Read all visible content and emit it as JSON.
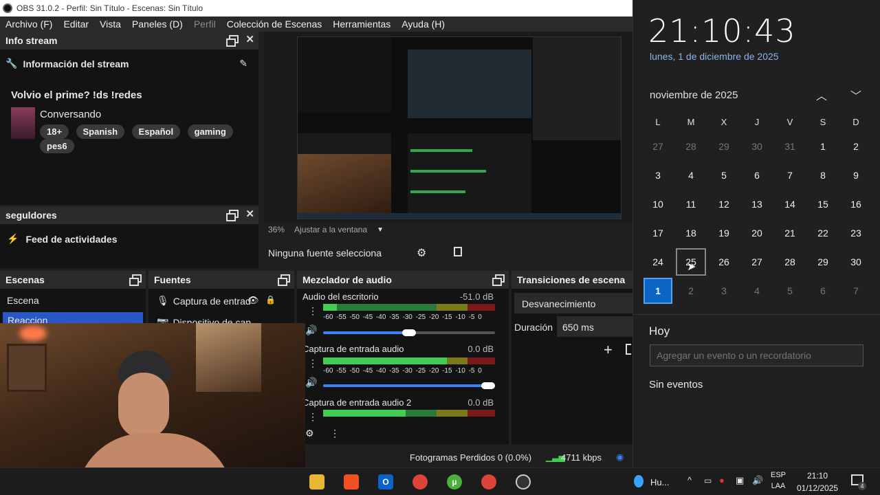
{
  "obs": {
    "title": "OBS 31.0.2 - Perfil: Sin Título - Escenas: Sin Título",
    "menu": [
      "Archivo (F)",
      "Editar",
      "Vista",
      "Paneles (D)",
      "Perfil",
      "Colección de Escenas",
      "Herramientas",
      "Ayuda (H)"
    ],
    "info_dock_title": "Info stream",
    "info_header": "Información del stream",
    "stream_title": "Volvio el prime? !ds !redes",
    "category": "Conversando",
    "tags": [
      "18+",
      "Spanish",
      "Español",
      "gaming",
      "pes6"
    ],
    "followers_dock_title": "seguldores",
    "feed_label": "Feed de actividades",
    "zoom": "36%",
    "fit_label": "Ajustar a la ventana",
    "no_source": "Ninguna fuente selecciona",
    "scenes_title": "Escenas",
    "scenes": [
      "Escena",
      "Reaccion"
    ],
    "sources_title": "Fuentes",
    "sources": [
      "Captura de entrad",
      "Dispositivo de cap"
    ],
    "mixer_title": "Mezclador de audio",
    "mixer": [
      {
        "name": "Audio del escritorio",
        "db": "-51.0 dB",
        "volume": 0.5
      },
      {
        "name": "Captura de entrada audio",
        "db": "0.0 dB",
        "volume": 1.0
      },
      {
        "name": "Captura de entrada audio 2",
        "db": "0.0 dB"
      }
    ],
    "meter_ticks": "-60 -55 -50 -45 -40 -35 -30 -25 -20 -15 -10 -5 0",
    "transitions_title": "Transiciones de escena",
    "transition": "Desvanecimiento",
    "duration_label": "Duración",
    "duration_value": "650 ms",
    "status_frames": "Fotogramas Perdidos 0 (0.0%)",
    "status_bitrate": "4711 kbps"
  },
  "calendar": {
    "time": "21:10:43",
    "date": "lunes, 1 de diciembre de 2025",
    "month": "noviembre de 2025",
    "weekdays": [
      "L",
      "M",
      "X",
      "J",
      "V",
      "S",
      "D"
    ],
    "weeks": [
      [
        "27",
        "28",
        "29",
        "30",
        "31",
        "1",
        "2"
      ],
      [
        "3",
        "4",
        "5",
        "6",
        "7",
        "8",
        "9"
      ],
      [
        "10",
        "11",
        "12",
        "13",
        "14",
        "15",
        "16"
      ],
      [
        "17",
        "18",
        "19",
        "20",
        "21",
        "22",
        "23"
      ],
      [
        "24",
        "25",
        "26",
        "27",
        "28",
        "29",
        "30"
      ],
      [
        "1",
        "2",
        "3",
        "4",
        "5",
        "6",
        "7"
      ]
    ],
    "today_label": "Hoy",
    "event_placeholder": "Agregar un evento o un recordatorio",
    "no_events": "Sin eventos"
  },
  "taskbar": {
    "weather": "Hu...",
    "lang_top": "ESP",
    "lang_bottom": "LAA",
    "clock_time": "21:10",
    "clock_date": "01/12/2025",
    "notifications": "4"
  }
}
